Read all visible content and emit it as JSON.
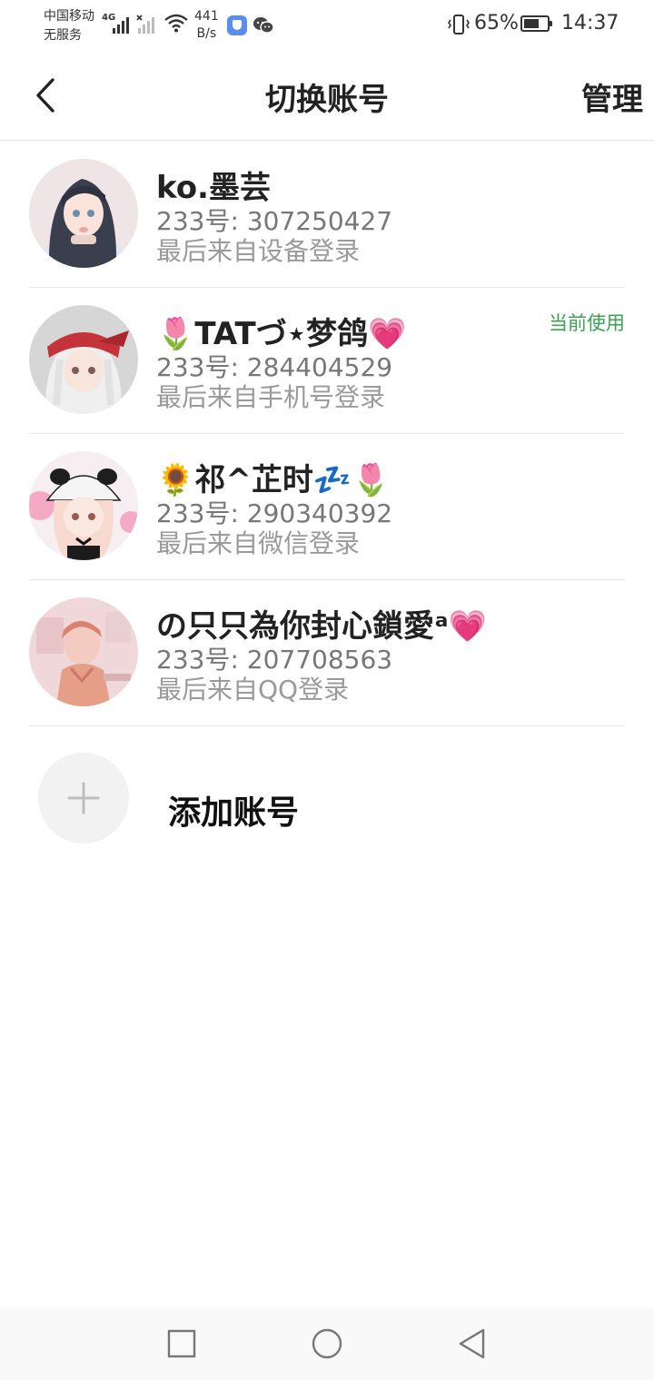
{
  "status_bar": {
    "carrier_line1": "中国移动",
    "carrier_line2": "无服务",
    "network_type": "4G",
    "speed_value": "441",
    "speed_unit": "B/s",
    "battery_percent": "65%",
    "battery_level": 0.65,
    "time": "14:37",
    "icons": [
      "signal-icon",
      "no-signal-icon",
      "wifi-icon",
      "app-notification-icon",
      "wechat-icon",
      "vibrate-icon",
      "battery-icon"
    ]
  },
  "header": {
    "back_icon": "back-arrow-icon",
    "title": "切换账号",
    "manage_label": "管理"
  },
  "accounts": [
    {
      "name": "ko.墨芸",
      "id_text": "233号: 307250427",
      "login_text": "最后来自设备登录",
      "current": ""
    },
    {
      "name": "🌷TATづ⋆梦鸽💗",
      "id_text": "233号: 284404529",
      "login_text": "最后来自手机号登录",
      "current": "当前使用"
    },
    {
      "name": "🌻祁^芷时💤🌷",
      "id_text": "233号: 290340392",
      "login_text": "最后来自微信登录",
      "current": ""
    },
    {
      "name": "の只只為你封心鎖愛ᵃ💗",
      "id_text": "233号: 207708563",
      "login_text": "最后来自QQ登录",
      "current": ""
    }
  ],
  "add_account": {
    "icon": "plus-icon",
    "label": "添加账号"
  },
  "nav_bar": {
    "icons": [
      "recents-square-icon",
      "home-circle-icon",
      "back-triangle-icon"
    ]
  },
  "colors": {
    "current_badge": "#3fa055",
    "divider": "#e9e9e9",
    "secondary_text": "#777777"
  }
}
